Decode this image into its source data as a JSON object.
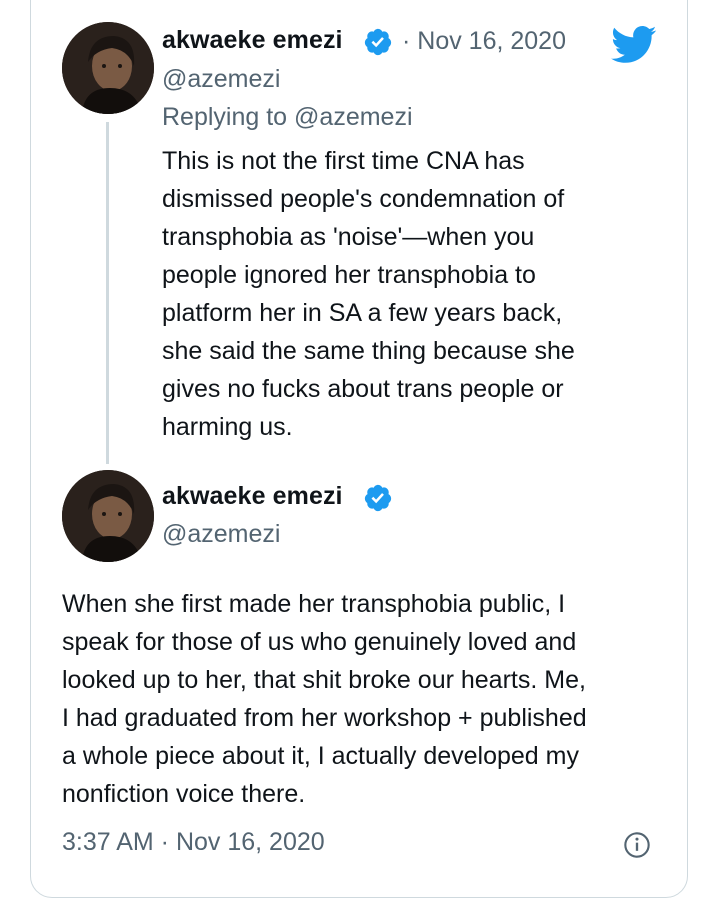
{
  "tweet1": {
    "author_name": "akwaeke emezi",
    "separator_date": "· Nov 16, 2020",
    "handle": "@azemezi",
    "replying_to_prefix": "Replying to",
    "replying_to_handle": "@azemezi",
    "text": "This is not the first time CNA has\ndismissed people's condemnation of\ntransphobia as 'noise'—when you\npeople ignored her transphobia to\nplatform her in SA a few years back,\nshe said the same thing because she\ngives no fucks about trans people or\nharming us."
  },
  "tweet2": {
    "author_name": "akwaeke emezi",
    "handle": "@azemezi",
    "text": "When she first made her transphobia public, I\nspeak for those of us who genuinely loved and\nlooked up to her, that shit broke our hearts. Me,\nI had graduated from her workshop + published\na whole piece about it, I actually developed my\nnonfiction voice there.",
    "timestamp": "3:37 AM · Nov 16, 2020"
  },
  "colors": {
    "twitter_blue": "#1d9bf0",
    "text_primary": "#0f1419",
    "text_secondary": "#536471",
    "border": "#cfd9de"
  },
  "icons": {
    "verified": "verified-badge-icon",
    "logo": "twitter-bird-icon",
    "info": "info-icon"
  }
}
